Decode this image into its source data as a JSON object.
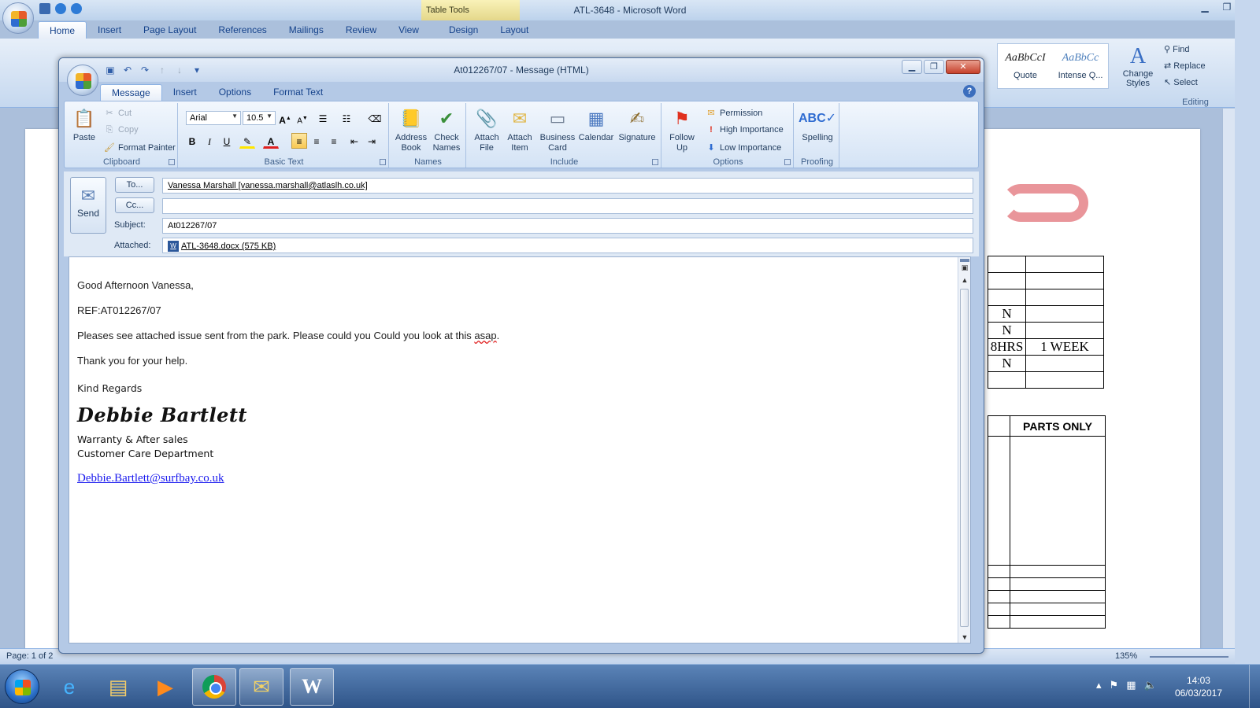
{
  "word": {
    "title": "ATL-3648 - Microsoft Word",
    "table_tools": "Table Tools",
    "tabs": [
      "Home",
      "Insert",
      "Page Layout",
      "References",
      "Mailings",
      "Review",
      "View",
      "Design",
      "Layout"
    ],
    "styles": [
      {
        "sample": "AaBbCcI",
        "name": "Quote"
      },
      {
        "sample": "AaBbCc",
        "name": "Intense Q..."
      }
    ],
    "change_styles": "Change Styles",
    "editing": {
      "find": "Find",
      "replace": "Replace",
      "select": "Select",
      "group": "Editing"
    },
    "doc_table": [
      [
        "",
        ""
      ],
      [
        "",
        ""
      ],
      [
        "",
        ""
      ],
      [
        "N",
        ""
      ],
      [
        "N",
        ""
      ],
      [
        "8HRS",
        "1 WEEK"
      ],
      [
        "N",
        ""
      ],
      [
        "",
        ""
      ]
    ],
    "parts_only": "PARTS ONLY",
    "status": {
      "page": "Page: 1 of 2",
      "zoom": "135%"
    }
  },
  "message": {
    "title": "At012267/07 - Message (HTML)",
    "tabs": [
      "Message",
      "Insert",
      "Options",
      "Format Text"
    ],
    "ribbon": {
      "clipboard": {
        "paste": "Paste",
        "cut": "Cut",
        "copy": "Copy",
        "format_painter": "Format Painter",
        "group": "Clipboard"
      },
      "basic_text": {
        "font": "Arial",
        "size": "10.5",
        "group": "Basic Text"
      },
      "names": {
        "address_book_1": "Address",
        "address_book_2": "Book",
        "check_names_1": "Check",
        "check_names_2": "Names",
        "group": "Names"
      },
      "include": {
        "attach_file_1": "Attach",
        "attach_file_2": "File",
        "attach_item_1": "Attach",
        "attach_item_2": "Item",
        "business_card_1": "Business",
        "business_card_2": "Card",
        "calendar": "Calendar",
        "signature": "Signature",
        "group": "Include"
      },
      "options": {
        "follow_up_1": "Follow",
        "follow_up_2": "Up",
        "permission": "Permission",
        "high_importance": "High Importance",
        "low_importance": "Low Importance",
        "group": "Options"
      },
      "proofing": {
        "spelling": "Spelling",
        "group": "Proofing"
      }
    },
    "header": {
      "send": "Send",
      "to_btn": "To...",
      "cc_btn": "Cc...",
      "subject_label": "Subject:",
      "attached_label": "Attached:",
      "to": "Vanessa Marshall [vanessa.marshall@atlaslh.co.uk]",
      "cc": "",
      "subject": "At012267/07",
      "attachment": "ATL-3648.docx (575 KB)"
    },
    "body": {
      "greeting": "Good Afternoon Vanessa,",
      "ref": "REF:AT012267/07",
      "line1_a": "Pleases see attached issue sent from the park. Please could you Could you look at this ",
      "line1_b": "asap",
      "line1_c": ".",
      "thanks": "Thank you for your help.",
      "regards": "Kind Regards",
      "sig_name": "Debbie Bartlett",
      "sig_line1": "Warranty  &  After sales",
      "sig_line2": "Customer Care Department",
      "sig_email": "Debbie.Bartlett@surfbay.co.uk"
    }
  },
  "taskbar": {
    "time": "14:03",
    "date": "06/03/2017"
  }
}
